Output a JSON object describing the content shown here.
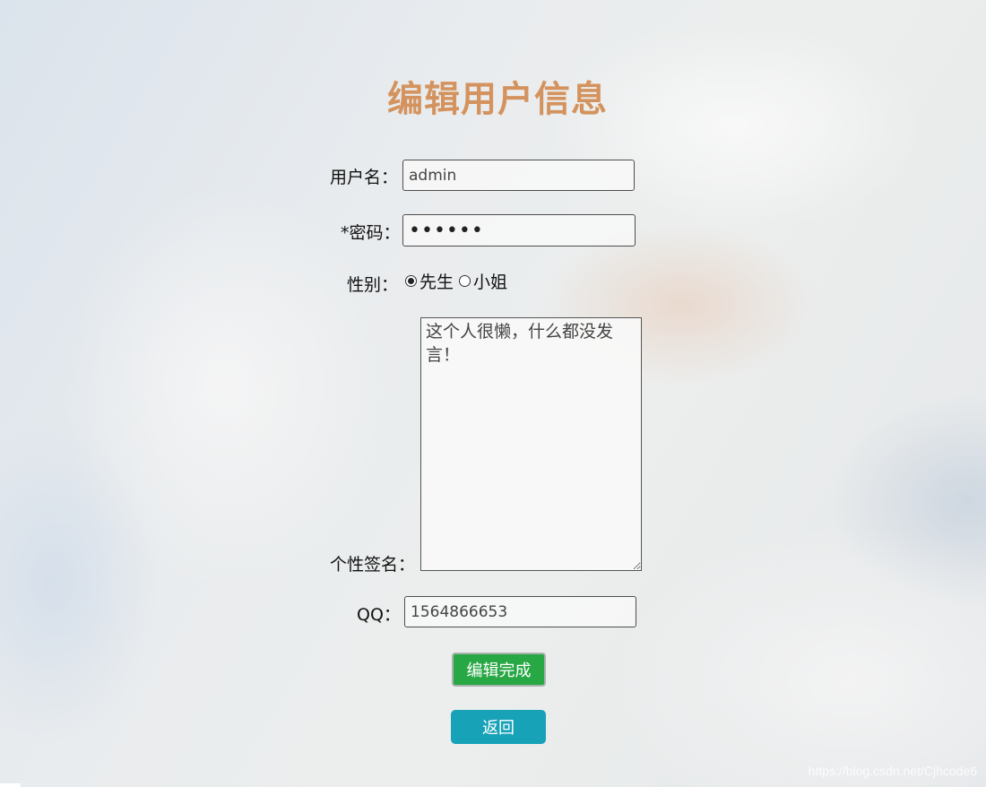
{
  "page": {
    "title": "编辑用户信息"
  },
  "form": {
    "username": {
      "label": "用户名：",
      "value": "admin"
    },
    "password": {
      "label": "*密码：",
      "value": "••••••"
    },
    "gender": {
      "label": "性别：",
      "options": [
        {
          "label": "先生",
          "checked": true
        },
        {
          "label": "小姐",
          "checked": false
        }
      ]
    },
    "signature": {
      "label": "个性签名：",
      "value": "这个人很懒，什么都没发言！"
    },
    "qq": {
      "label": "QQ：",
      "value": "1564866653"
    }
  },
  "buttons": {
    "submit_label": "编辑完成",
    "back_label": "返回"
  },
  "watermark": "https://blog.csdn.net/Cjhcode6",
  "colors": {
    "title": "#d4935e",
    "submit_button": "#28a745",
    "back_button": "#17a2b8"
  }
}
